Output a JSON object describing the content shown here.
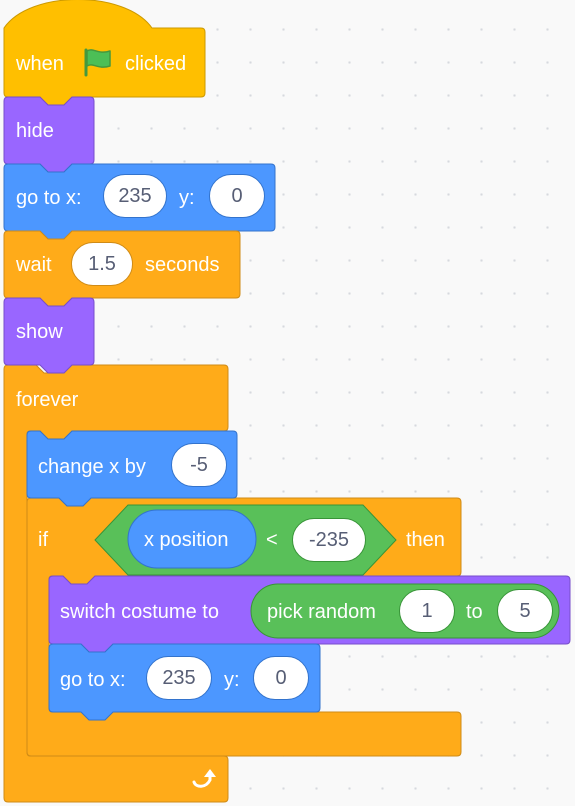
{
  "colors": {
    "events": "#ffbf00",
    "looks": "#9966ff",
    "motion": "#4c97ff",
    "control": "#ffab19",
    "operators": "#59c059",
    "input_text": "#575e75"
  },
  "script": {
    "hat": {
      "before": "when",
      "icon": "green-flag-icon",
      "after": "clicked"
    },
    "hide": {
      "label": "hide"
    },
    "goto1": {
      "label": "go to x:",
      "x": "235",
      "ylabel": "y:",
      "y": "0"
    },
    "wait": {
      "label": "wait",
      "value": "1.5",
      "unit": "seconds"
    },
    "show": {
      "label": "show"
    },
    "forever": {
      "label": "forever",
      "loop_icon": "loop-arrow-icon"
    },
    "change_x": {
      "label": "change x by",
      "value": "-5"
    },
    "if_block": {
      "if_label": "if",
      "then_label": "then",
      "condition": {
        "reporter": "x position",
        "operator": "<",
        "value": "-235"
      }
    },
    "switch_costume": {
      "label": "switch costume to",
      "random_label": "pick random",
      "from": "1",
      "to_label": "to",
      "to": "5"
    },
    "goto2": {
      "label": "go to x:",
      "x": "235",
      "ylabel": "y:",
      "y": "0"
    }
  }
}
